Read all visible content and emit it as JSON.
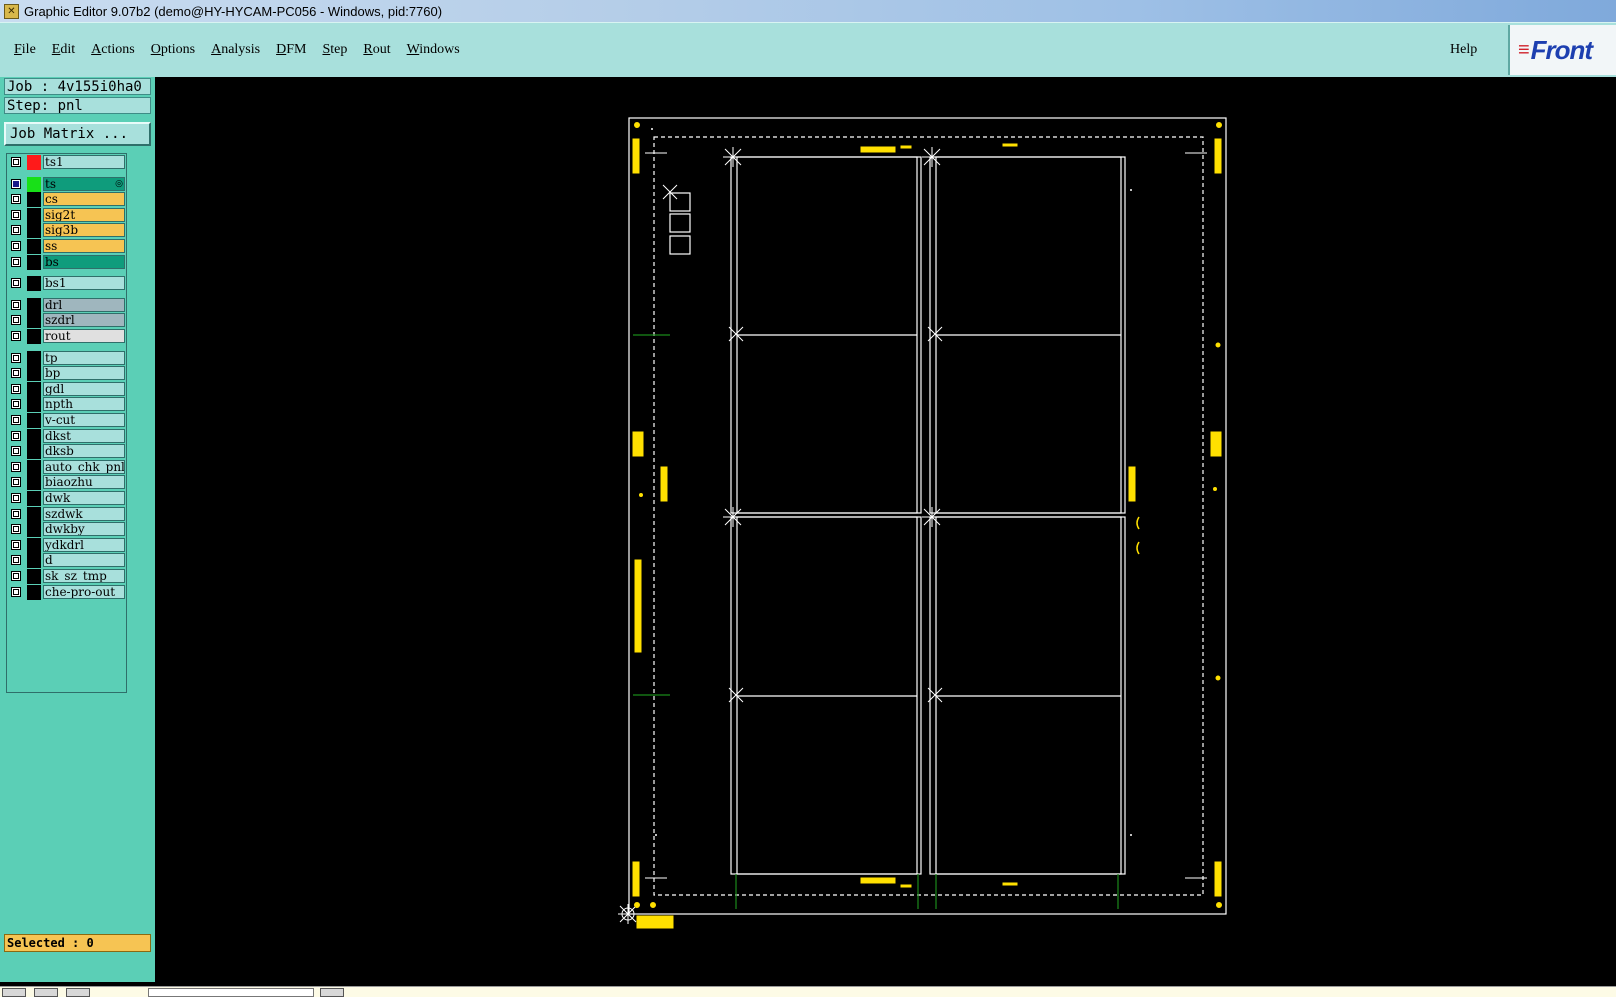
{
  "window": {
    "title": "Graphic Editor 9.07b2 (demo@HY-HYCAM-PC056 - Windows, pid:7760)"
  },
  "menu": {
    "items": [
      {
        "first": "F",
        "rest": "ile"
      },
      {
        "first": "E",
        "rest": "dit"
      },
      {
        "first": "A",
        "rest": "ctions"
      },
      {
        "first": "O",
        "rest": "ptions"
      },
      {
        "first": "A",
        "rest": "nalysis"
      },
      {
        "first": "D",
        "rest": "FM"
      },
      {
        "first": "S",
        "rest": "tep"
      },
      {
        "first": "R",
        "rest": "out"
      },
      {
        "first": "W",
        "rest": "indows"
      }
    ],
    "help": "Help"
  },
  "logo": {
    "mark": "≡",
    "text": "Front"
  },
  "job": {
    "job_label": "Job : 4v155i0ha0",
    "step_label": "Step: pnl",
    "matrix_button": "Job Matrix ..."
  },
  "layers": [
    {
      "name": "ts1",
      "color": "#a8e0dc",
      "swatch": "#ff1a1a",
      "checked": false
    },
    {
      "name": "ts",
      "color": "#0f9c7c",
      "swatch": "#18e018",
      "checked": true,
      "marker": "◎"
    },
    {
      "name": "cs",
      "color": "#f6c453",
      "swatch": "#000000",
      "checked": false
    },
    {
      "name": "sig2t",
      "color": "#f6c453",
      "swatch": "#000000",
      "checked": false
    },
    {
      "name": "sig3b",
      "color": "#f6c453",
      "swatch": "#000000",
      "checked": false
    },
    {
      "name": "ss",
      "color": "#f6c453",
      "swatch": "#000000",
      "checked": false
    },
    {
      "name": "bs",
      "color": "#0f9c7c",
      "swatch": "#000000",
      "checked": false
    },
    {
      "name": "bs1",
      "color": "#a8e0dc",
      "swatch": "#000000",
      "checked": false
    },
    {
      "name": "drl",
      "color": "#9fb6be",
      "swatch": "#000000",
      "checked": false
    },
    {
      "name": "szdrl",
      "color": "#9fb6be",
      "swatch": "#000000",
      "checked": false
    },
    {
      "name": "rout",
      "color": "#e0e0e0",
      "swatch": "#000000",
      "checked": false
    },
    {
      "name": "tp",
      "color": "#a8e0dc",
      "swatch": "#000000",
      "checked": false
    },
    {
      "name": "bp",
      "color": "#a8e0dc",
      "swatch": "#000000",
      "checked": false
    },
    {
      "name": "gdl",
      "color": "#a8e0dc",
      "swatch": "#000000",
      "checked": false
    },
    {
      "name": "npth",
      "color": "#a8e0dc",
      "swatch": "#000000",
      "checked": false
    },
    {
      "name": "v-cut",
      "color": "#a8e0dc",
      "swatch": "#000000",
      "checked": false
    },
    {
      "name": "dkst",
      "color": "#a8e0dc",
      "swatch": "#000000",
      "checked": false
    },
    {
      "name": "dksb",
      "color": "#a8e0dc",
      "swatch": "#000000",
      "checked": false
    },
    {
      "name": "auto_chk_pnl",
      "color": "#a8e0dc",
      "swatch": "#000000",
      "checked": false
    },
    {
      "name": "biaozhu",
      "color": "#a8e0dc",
      "swatch": "#000000",
      "checked": false
    },
    {
      "name": "dwk",
      "color": "#a8e0dc",
      "swatch": "#000000",
      "checked": false
    },
    {
      "name": "szdwk",
      "color": "#a8e0dc",
      "swatch": "#000000",
      "checked": false
    },
    {
      "name": "dwkby",
      "color": "#a8e0dc",
      "swatch": "#000000",
      "checked": false
    },
    {
      "name": "ydkdrl",
      "color": "#a8e0dc",
      "swatch": "#000000",
      "checked": false
    },
    {
      "name": "d",
      "color": "#a8e0dc",
      "swatch": "#000000",
      "checked": false
    },
    {
      "name": "sk_sz_tmp",
      "color": "#a8e0dc",
      "swatch": "#000000",
      "checked": false
    },
    {
      "name": "che-pro-out",
      "color": "#a8e0dc",
      "swatch": "#000000",
      "checked": false
    }
  ],
  "status": {
    "selected_label": "Selected : 0"
  },
  "colors": {
    "outline": "#ffffff",
    "pad": "#ffe000",
    "guide": "#1a8a1a",
    "canvas": "#000000"
  }
}
